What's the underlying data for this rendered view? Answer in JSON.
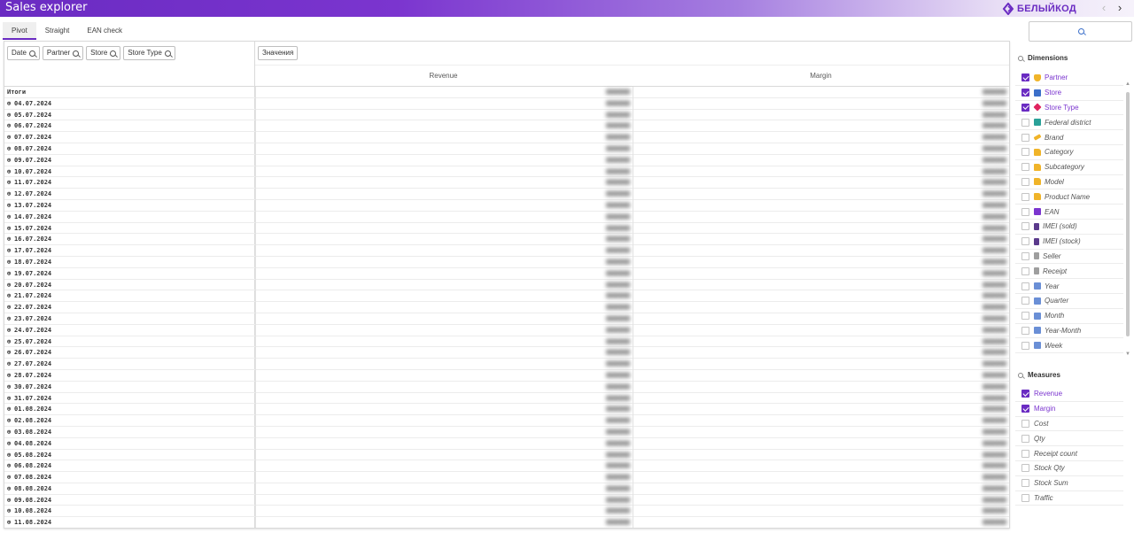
{
  "app": {
    "title": "Sales explorer",
    "logo_text": "БЕЛЫЙКОД",
    "nav_prev": "‹",
    "nav_next": "›"
  },
  "tabs": [
    {
      "label": "Pivot",
      "active": true
    },
    {
      "label": "Straight"
    },
    {
      "label": "EAN check"
    }
  ],
  "filters": [
    "Date",
    "Partner",
    "Store",
    "Store Type"
  ],
  "values_label": "Значения",
  "columns": [
    "Revenue",
    "Margin"
  ],
  "rows": [
    {
      "label": "Итоги",
      "total": true
    },
    {
      "label": "04.07.2024"
    },
    {
      "label": "05.07.2024"
    },
    {
      "label": "06.07.2024"
    },
    {
      "label": "07.07.2024"
    },
    {
      "label": "08.07.2024"
    },
    {
      "label": "09.07.2024"
    },
    {
      "label": "10.07.2024"
    },
    {
      "label": "11.07.2024"
    },
    {
      "label": "12.07.2024"
    },
    {
      "label": "13.07.2024"
    },
    {
      "label": "14.07.2024"
    },
    {
      "label": "15.07.2024"
    },
    {
      "label": "16.07.2024"
    },
    {
      "label": "17.07.2024"
    },
    {
      "label": "18.07.2024"
    },
    {
      "label": "19.07.2024"
    },
    {
      "label": "20.07.2024"
    },
    {
      "label": "21.07.2024"
    },
    {
      "label": "22.07.2024"
    },
    {
      "label": "23.07.2024"
    },
    {
      "label": "24.07.2024"
    },
    {
      "label": "25.07.2024"
    },
    {
      "label": "26.07.2024"
    },
    {
      "label": "27.07.2024"
    },
    {
      "label": "28.07.2024"
    },
    {
      "label": "30.07.2024"
    },
    {
      "label": "31.07.2024"
    },
    {
      "label": "01.08.2024"
    },
    {
      "label": "02.08.2024"
    },
    {
      "label": "03.08.2024"
    },
    {
      "label": "04.08.2024"
    },
    {
      "label": "05.08.2024"
    },
    {
      "label": "06.08.2024"
    },
    {
      "label": "07.08.2024"
    },
    {
      "label": "08.08.2024"
    },
    {
      "label": "09.08.2024"
    },
    {
      "label": "10.08.2024"
    },
    {
      "label": "11.08.2024"
    }
  ],
  "side": {
    "dimensions_title": "Dimensions",
    "dimensions": [
      {
        "label": "Partner",
        "checked": true,
        "icon": "shield-icon",
        "color": "#f0b429"
      },
      {
        "label": "Store",
        "checked": true,
        "icon": "store-icon",
        "color": "#3b6fc9"
      },
      {
        "label": "Store Type",
        "checked": true,
        "icon": "tag-icon",
        "color": "#e0245e"
      },
      {
        "label": "Federal district",
        "checked": false,
        "icon": "map-icon",
        "color": "#2aa198"
      },
      {
        "label": "Brand",
        "checked": false,
        "icon": "pen-icon",
        "color": "#f0b429"
      },
      {
        "label": "Category",
        "checked": false,
        "icon": "folder-icon",
        "color": "#f0b429"
      },
      {
        "label": "Subcategory",
        "checked": false,
        "icon": "folder-icon",
        "color": "#f0b429"
      },
      {
        "label": "Model",
        "checked": false,
        "icon": "folder-icon",
        "color": "#f0b429"
      },
      {
        "label": "Product Name",
        "checked": false,
        "icon": "folder-icon",
        "color": "#f0b429"
      },
      {
        "label": "EAN",
        "checked": false,
        "icon": "barcode-icon",
        "color": "#7b35cf"
      },
      {
        "label": "IMEI (sold)",
        "checked": false,
        "icon": "phone-icon",
        "color": "#5b3a8c"
      },
      {
        "label": "IMEI (stock)",
        "checked": false,
        "icon": "phone-icon",
        "color": "#5b3a8c"
      },
      {
        "label": "Seller",
        "checked": false,
        "icon": "receipt-icon",
        "color": "#9e9e9e"
      },
      {
        "label": "Receipt",
        "checked": false,
        "icon": "receipt-icon",
        "color": "#9e9e9e"
      },
      {
        "label": "Year",
        "checked": false,
        "icon": "calendar-icon",
        "color": "#6a8fd6"
      },
      {
        "label": "Quarter",
        "checked": false,
        "icon": "calendar-icon",
        "color": "#6a8fd6"
      },
      {
        "label": "Month",
        "checked": false,
        "icon": "calendar-icon",
        "color": "#6a8fd6"
      },
      {
        "label": "Year-Month",
        "checked": false,
        "icon": "calendar-icon",
        "color": "#6a8fd6"
      },
      {
        "label": "Week",
        "checked": false,
        "icon": "calendar-icon",
        "color": "#6a8fd6"
      }
    ],
    "measures_title": "Measures",
    "measures": [
      {
        "label": "Revenue",
        "checked": true
      },
      {
        "label": "Margin",
        "checked": true
      },
      {
        "label": "Cost",
        "checked": false
      },
      {
        "label": "Qty",
        "checked": false
      },
      {
        "label": "Receipt count",
        "checked": false
      },
      {
        "label": "Stock Qty",
        "checked": false
      },
      {
        "label": "Stock Sum",
        "checked": false
      },
      {
        "label": "Traffic",
        "checked": false
      }
    ]
  },
  "colors": {
    "accent": "#6a2bc2"
  }
}
